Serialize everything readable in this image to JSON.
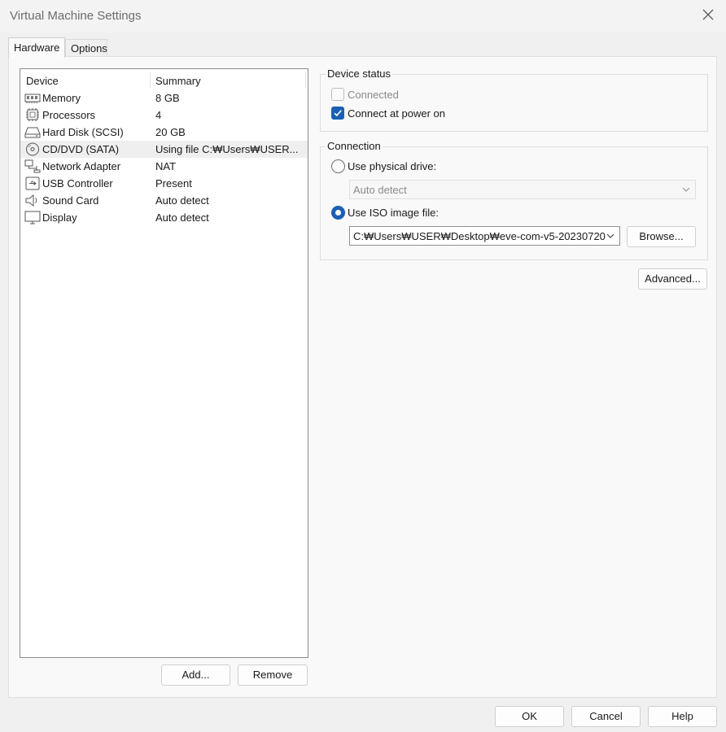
{
  "window": {
    "title": "Virtual Machine Settings"
  },
  "tabs": [
    {
      "label": "Hardware",
      "active": true
    },
    {
      "label": "Options",
      "active": false
    }
  ],
  "device_list": {
    "columns": [
      "Device",
      "Summary"
    ],
    "rows": [
      {
        "icon": "memory-icon",
        "device": "Memory",
        "summary": "8 GB",
        "selected": false
      },
      {
        "icon": "processor-icon",
        "device": "Processors",
        "summary": "4",
        "selected": false
      },
      {
        "icon": "hard-disk-icon",
        "device": "Hard Disk (SCSI)",
        "summary": "20 GB",
        "selected": false
      },
      {
        "icon": "cd-dvd-icon",
        "device": "CD/DVD (SATA)",
        "summary": "Using file C:₩Users₩USER...",
        "selected": true
      },
      {
        "icon": "network-adapter-icon",
        "device": "Network Adapter",
        "summary": "NAT",
        "selected": false
      },
      {
        "icon": "usb-controller-icon",
        "device": "USB Controller",
        "summary": "Present",
        "selected": false
      },
      {
        "icon": "sound-card-icon",
        "device": "Sound Card",
        "summary": "Auto detect",
        "selected": false
      },
      {
        "icon": "display-icon",
        "device": "Display",
        "summary": "Auto detect",
        "selected": false
      }
    ],
    "add_label": "Add...",
    "remove_label": "Remove"
  },
  "device_status": {
    "title": "Device status",
    "connected": {
      "label": "Connected",
      "checked": false,
      "disabled": true
    },
    "connect_at_power_on": {
      "label": "Connect at power on",
      "checked": true
    }
  },
  "connection": {
    "title": "Connection",
    "physical_drive": {
      "label": "Use physical drive:",
      "selected": false,
      "value": "Auto detect"
    },
    "iso_image": {
      "label": "Use ISO image file:",
      "selected": true,
      "value": "C:₩Users₩USER₩Desktop₩eve-com-v5-20230720"
    },
    "browse_label": "Browse..."
  },
  "advanced_label": "Advanced...",
  "footer": {
    "ok_label": "OK",
    "cancel_label": "Cancel",
    "help_label": "Help"
  },
  "colors": {
    "accent": "#1a5fb4",
    "panel": "#f9f9f9",
    "window": "#f0f0f0"
  }
}
